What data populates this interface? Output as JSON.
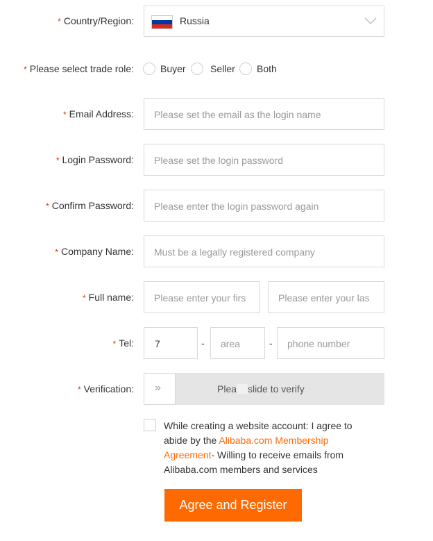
{
  "form": {
    "required_mark": "*",
    "country": {
      "label": "Country/Region:",
      "value": "Russia",
      "flag": "russia-flag"
    },
    "trade_role": {
      "label": "Please select trade role:",
      "options": [
        "Buyer",
        "Seller",
        "Both"
      ]
    },
    "email": {
      "label": "Email Address:",
      "placeholder": "Please set the email as the login name"
    },
    "password": {
      "label": "Login Password:",
      "placeholder": "Please set the login password"
    },
    "confirm_password": {
      "label": "Confirm Password:",
      "placeholder": "Please enter the login password again"
    },
    "company": {
      "label": "Company Name:",
      "placeholder": "Must be a legally registered company"
    },
    "full_name": {
      "label": "Full name:",
      "first_placeholder": "Please enter your firs",
      "last_placeholder": "Please enter your las"
    },
    "tel": {
      "label": "Tel:",
      "country_code": "7",
      "separator": "-",
      "area_placeholder": "area",
      "phone_placeholder": "phone number"
    },
    "verification": {
      "label": "Verification:",
      "handle_glyph": "»",
      "text_start": "Plea",
      "text_end": "slide to verify"
    },
    "agreement": {
      "text_before": "While creating a website account: I agree to abide by the ",
      "link_text": "Alibaba.com Membership Agreement",
      "text_after": "- Willing to receive emails from Alibaba.com members and services"
    },
    "submit_label": "Agree and Register"
  },
  "colors": {
    "accent": "#ff6a00",
    "required": "#e62e04",
    "slider_bg": "#e5e5e5",
    "border": "#d8d8d8"
  }
}
